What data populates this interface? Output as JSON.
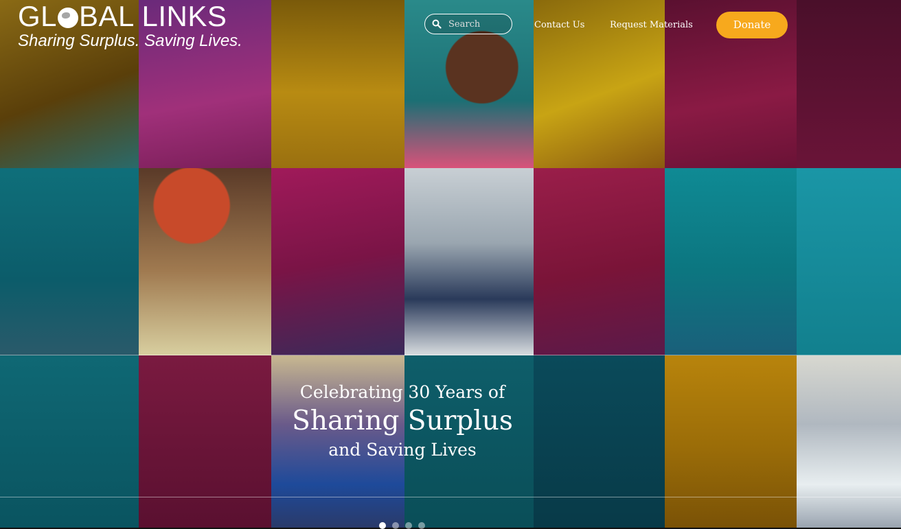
{
  "brand": {
    "title_before": "GL",
    "title_after": "BAL LINKS",
    "tagline": "Sharing Surplus. Saving Lives."
  },
  "search": {
    "placeholder": "Search"
  },
  "nav": {
    "contact": "Contact Us",
    "request": "Request Materials",
    "donate": "Donate"
  },
  "hero": {
    "line1": "Celebrating 30 Years of",
    "line2": "Sharing Surplus",
    "line3": "and Saving Lives"
  },
  "carousel": {
    "slides": 4,
    "active": 1
  },
  "colors": {
    "accent": "#f7a91d",
    "teal": "#0d7f8f",
    "magenta": "#b0185e",
    "gold": "#c9950c",
    "purple": "#5a2a6e"
  }
}
